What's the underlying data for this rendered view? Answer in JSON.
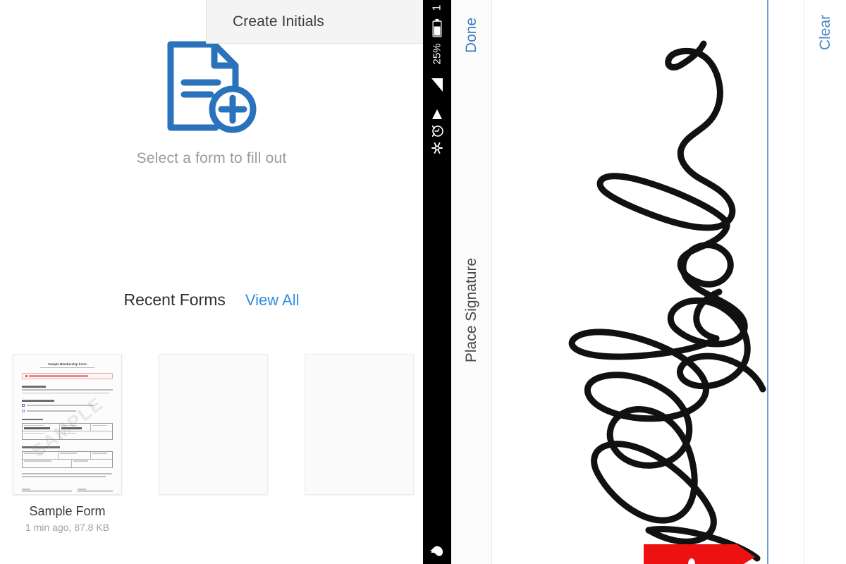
{
  "left_panel": {
    "create_initials_menu": {
      "label": "Create Initials"
    },
    "empty_state": {
      "icon": "document-add-icon",
      "text": "Select a form to fill out"
    },
    "recent_forms": {
      "title": "Recent Forms",
      "view_all_label": "View All",
      "items": [
        {
          "name": "Sample Form",
          "meta": "1 min ago, 87.8 KB",
          "has_preview": true,
          "preview": {
            "doc_title": "Sample Membership Form",
            "watermark": "SAMPLE",
            "alert_present": true
          }
        },
        {
          "name": "",
          "meta": "",
          "has_preview": false
        },
        {
          "name": "",
          "meta": "",
          "has_preview": false
        }
      ]
    }
  },
  "status_bar": {
    "clock": "1",
    "battery_percent": "25%",
    "icons": [
      "battery-icon",
      "signal-icon",
      "play-triangle-icon",
      "alarm-clock-icon",
      "vibrate-icon",
      "flame-icon"
    ]
  },
  "signature_panel": {
    "done_label": "Done",
    "title": "Place Signature",
    "clear_label": "Clear",
    "baseline_color": "#6f9fd0",
    "ink_color": "#111111",
    "arrow_color": "#ee1111"
  },
  "colors": {
    "accent_blue": "#2f8fe0",
    "link_blue": "#3b7cc4",
    "icon_blue": "#2b72bd",
    "muted_text": "#9b9b9b",
    "status_bar_bg": "#000000"
  }
}
